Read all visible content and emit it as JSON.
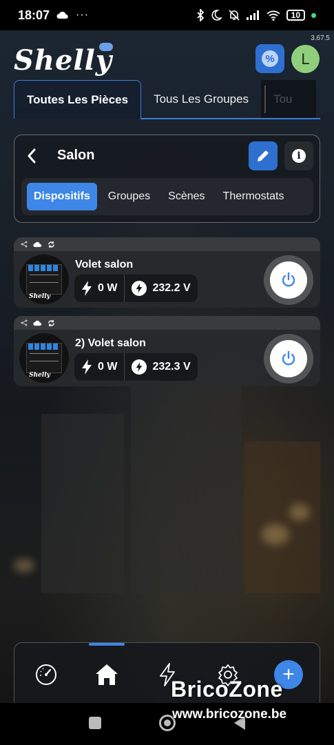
{
  "status_bar": {
    "time": "18:07",
    "battery": "10",
    "icons": [
      "cloud-icon",
      "more-icon",
      "bluetooth-icon",
      "moon-icon",
      "mute-icon",
      "signal-icon",
      "wifi-icon",
      "battery-icon"
    ]
  },
  "app": {
    "version": "3.67.5",
    "logo_text": "Shelly",
    "avatar_initial": "L",
    "badge_symbol": "%"
  },
  "tabs": [
    {
      "label": "Toutes Les Pièces",
      "active": true
    },
    {
      "label": "Tous Les Groupes",
      "active": false
    },
    {
      "label": "Tou",
      "active": false
    }
  ],
  "room": {
    "title": "Salon",
    "subtabs": [
      {
        "label": "Dispositifs",
        "active": true
      },
      {
        "label": "Groupes",
        "active": false
      },
      {
        "label": "Scènes",
        "active": false
      },
      {
        "label": "Thermostats",
        "active": false
      }
    ]
  },
  "devices": [
    {
      "name": "Volet salon",
      "power": "0 W",
      "voltage": "232.2 V",
      "brand": "Shelly"
    },
    {
      "name": "2) Volet salon",
      "power": "0 W",
      "voltage": "232.3 V",
      "brand": "Shelly"
    }
  ],
  "bottom_nav": {
    "items": [
      "dashboard-icon",
      "home-icon",
      "energy-icon",
      "settings-icon",
      "add-icon"
    ],
    "active": "home-icon",
    "add_symbol": "+"
  },
  "watermark": {
    "title": "BricoZone",
    "url": "www.bricozone.be"
  },
  "colors": {
    "accent": "#3e86e8",
    "primary_button": "#2f6fd0",
    "avatar": "#8fcf7c"
  }
}
